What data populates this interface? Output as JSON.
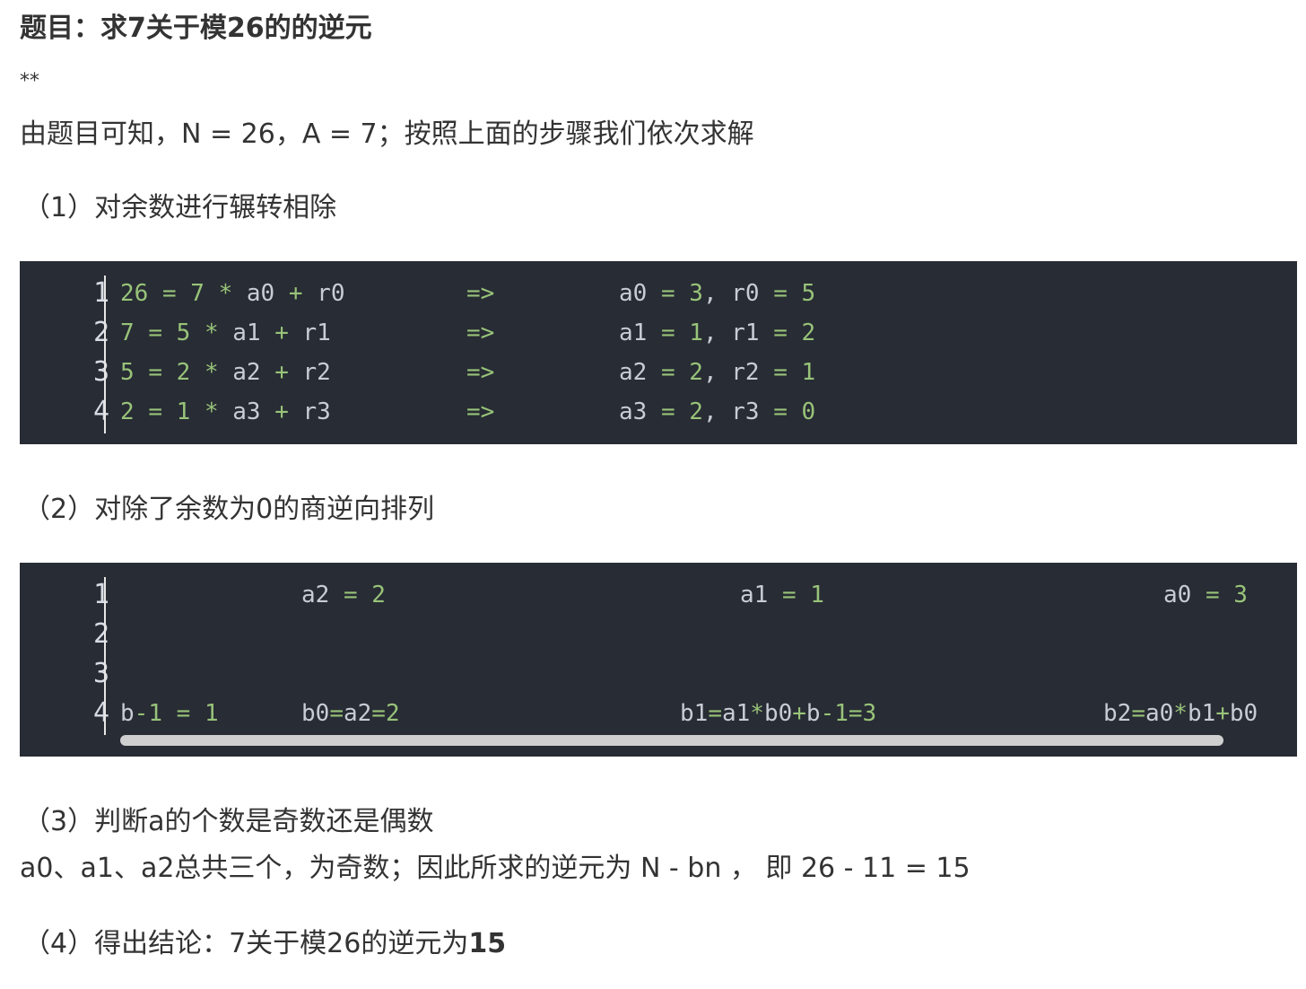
{
  "title": "题目：求7关于模26的的逆元",
  "stars": "**",
  "intro": "由题目可知，N = 26，A = 7；按照上面的步骤我们依次求解",
  "step1": "（1）对余数进行辗转相除",
  "code1": {
    "line_numbers": [
      "1",
      "2",
      "3",
      "4"
    ],
    "lines": [
      [
        "26",
        "=",
        "7",
        "*",
        "a0",
        "+",
        "r0",
        "=>",
        "a0",
        "=",
        "3",
        ",",
        "r0",
        "=",
        "5"
      ],
      [
        "7",
        "=",
        "5",
        "*",
        "a1",
        "+",
        "r1",
        "=>",
        "a1",
        "=",
        "1",
        ",",
        "r1",
        "=",
        "2"
      ],
      [
        "5",
        "=",
        "2",
        "*",
        "a2",
        "+",
        "r2",
        "=>",
        "a2",
        "=",
        "2",
        ",",
        "r2",
        "=",
        "1"
      ],
      [
        "2",
        "=",
        "1",
        "*",
        "a3",
        "+",
        "r3",
        "=>",
        "a3",
        "=",
        "2",
        ",",
        "r3",
        "=",
        "0"
      ]
    ]
  },
  "step2": "（2）对除了余数为0的商逆向排列",
  "code2": {
    "line_numbers": [
      "1",
      "2",
      "3",
      "4"
    ],
    "row1": {
      "a2": "a2",
      "eq1": "=",
      "v1": "2",
      "a1": "a1",
      "eq2": "=",
      "v2": "1",
      "a0": "a0",
      "eq3": "=",
      "v3": "3"
    },
    "row4": {
      "bm1": "b",
      "bm1_minus": "-",
      "bm1_one": "1",
      "bm1_eq": "=",
      "bm1_val": "1",
      "b0_a": "b0",
      "b0_eq1": "=",
      "b0_b": "a2",
      "b0_eq2": "=",
      "b0_v": "2",
      "b1_a": "b1",
      "b1_eq1": "=",
      "b1_b": "a1",
      "b1_mul": "*",
      "b1_c": "b0",
      "b1_plus": "+",
      "b1_d": "b",
      "b1_minus": "-",
      "b1_e": "1",
      "b1_eq2": "=",
      "b1_v": "3",
      "b2_a": "b2",
      "b2_eq1": "=",
      "b2_b": "a0",
      "b2_mul": "*",
      "b2_c": "b1",
      "b2_plus": "+",
      "b2_d": "b0"
    }
  },
  "step3": "（3）判断a的个数是奇数还是偶数",
  "step3_detail": "a0、a1、a2总共三个，为奇数；因此所求的逆元为 N - bn ， 即 26 - 11 = 15",
  "step4_prefix": "（4）得出结论：7关于模26的逆元为",
  "step4_answer": "15"
}
